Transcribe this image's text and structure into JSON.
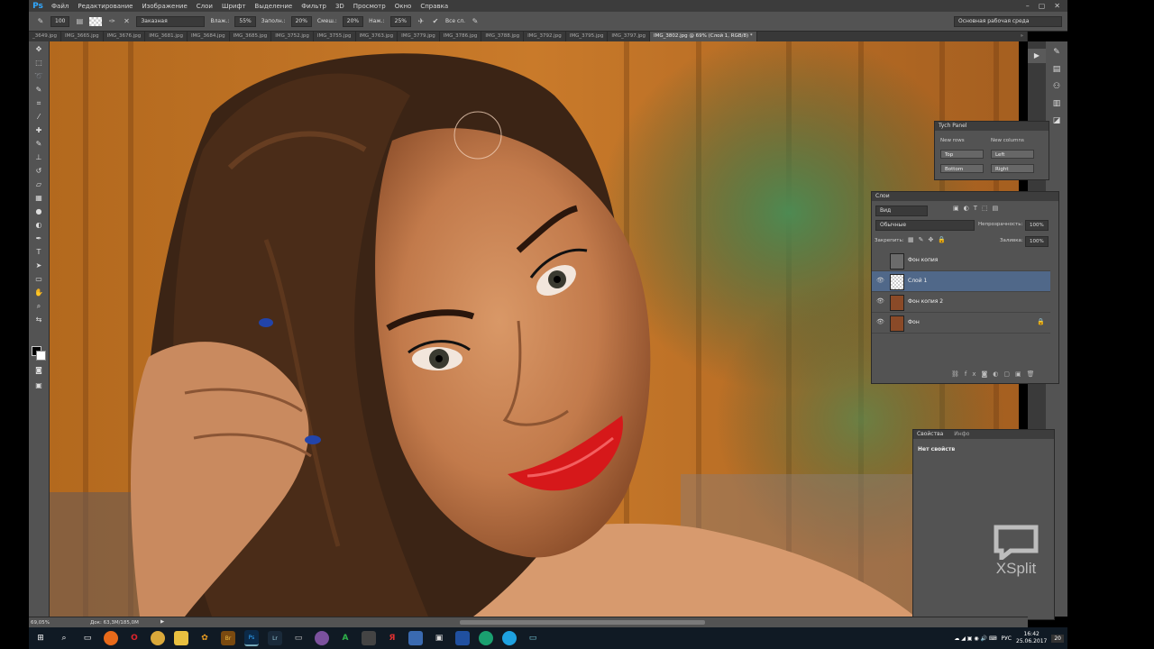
{
  "menu": {
    "logo": "Ps",
    "items": [
      "Файл",
      "Редактирование",
      "Изображение",
      "Слои",
      "Шрифт",
      "Выделение",
      "Фильтр",
      "3D",
      "Просмотр",
      "Окно",
      "Справка"
    ],
    "window_buttons": [
      "–",
      "▢",
      "✕"
    ]
  },
  "options": {
    "brush_size": "100",
    "mode_label": "Заказная",
    "flow_label": "Влаж.:",
    "flow_value": "55%",
    "load_label": "Заполн.:",
    "load_value": "20%",
    "mix_label": "Смеш.:",
    "mix_value": "20%",
    "pressure_label": "Наж.:",
    "pressure_value": "25%",
    "sample_all": "Все сл.",
    "workspace": "Основная рабочая среда"
  },
  "tabs": [
    "_3649.jpg",
    "IMG_3665.jpg",
    "IMG_3676.jpg",
    "IMG_3681.jpg",
    "IMG_3684.jpg",
    "IMG_3685.jpg",
    "IMG_3752.jpg",
    "IMG_3755.jpg",
    "IMG_3763.jpg",
    "IMG_3779.jpg",
    "IMG_3786.jpg",
    "IMG_3788.jpg",
    "IMG_3792.jpg",
    "IMG_3795.jpg",
    "IMG_3797.jpg",
    "IMG_3802.jpg @ 69% (Слой 1, RGB/8) *"
  ],
  "tabs_more": "»",
  "tych": {
    "title": "Tych Panel",
    "new_rows": "New rows",
    "new_columns": "New columns",
    "top": "Top",
    "left": "Left",
    "bottom": "Bottom",
    "right": "Right"
  },
  "layers": {
    "title": "Слои",
    "filter": "Вид",
    "blend_mode": "Обычные",
    "opacity_label": "Непрозрачность:",
    "opacity_value": "100%",
    "lock_label": "Закрепить:",
    "fill_label": "Заливка:",
    "fill_value": "100%",
    "rows": [
      {
        "name": "Фон копия",
        "visible": false,
        "selected": false
      },
      {
        "name": "Слой 1",
        "visible": true,
        "selected": true
      },
      {
        "name": "Фон копия 2",
        "visible": true,
        "selected": false
      },
      {
        "name": "Фон",
        "visible": true,
        "selected": false,
        "locked": true
      }
    ]
  },
  "properties": {
    "tab_props": "Свойства",
    "tab_info": "Инфо",
    "content": "Нет свойств"
  },
  "status": {
    "zoom": "69,05%",
    "doc": "Док: 63,3M/185,0M"
  },
  "watermark": "XSplit",
  "taskbar": {
    "lang": "РУС",
    "time": "16:42",
    "date": "25.06.2017",
    "notif": "20"
  },
  "colors": {
    "accent": "#31a8ff",
    "selected_layer": "#506889",
    "panel_bg": "#535353"
  }
}
